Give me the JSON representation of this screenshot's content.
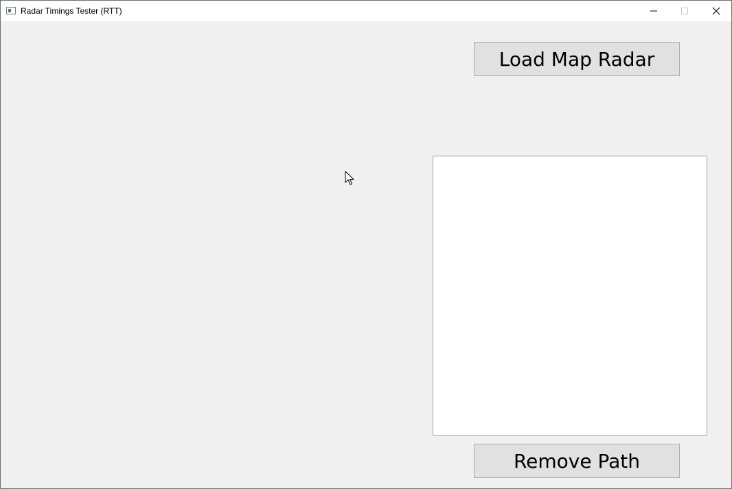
{
  "window": {
    "title": "Radar Timings Tester (RTT)",
    "controls": {
      "minimize_icon": "minimize-icon",
      "maximize_icon": "maximize-icon",
      "close_icon": "close-icon"
    }
  },
  "main": {
    "load_button_label": "Load Map Radar",
    "path_list_items": [],
    "remove_button_label": "Remove Path"
  },
  "colors": {
    "window_background": "#f0f0f0",
    "titlebar_background": "#ffffff",
    "button_background": "#e1e1e1",
    "button_border": "#adadad",
    "listbox_background": "#ffffff"
  }
}
